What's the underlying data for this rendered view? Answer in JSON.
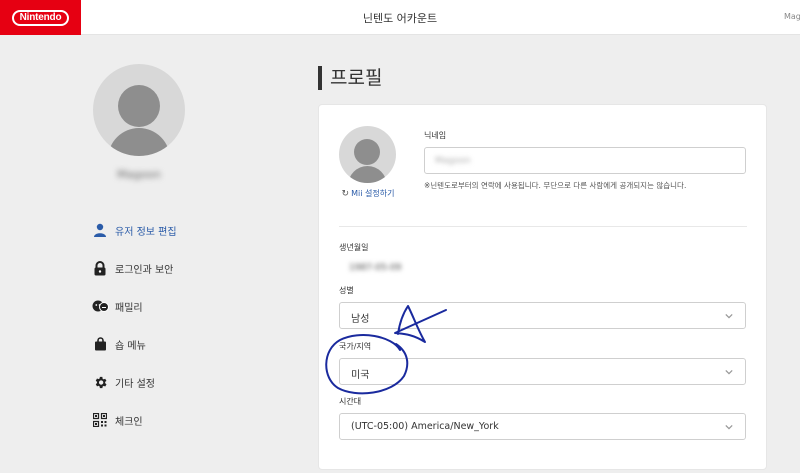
{
  "header": {
    "logo_text": "Nintendo",
    "title": "닌텐도 어카운트",
    "user_label": "Mag"
  },
  "sidebar": {
    "username": "Magoon",
    "items": [
      {
        "label": "유저 정보 편집",
        "icon": "person-icon",
        "active": true
      },
      {
        "label": "로그인과 보안",
        "icon": "lock-icon",
        "active": false
      },
      {
        "label": "패밀리",
        "icon": "family-icon",
        "active": false
      },
      {
        "label": "숍 메뉴",
        "icon": "shopping-bag-icon",
        "active": false
      },
      {
        "label": "기타 설정",
        "icon": "gear-icon",
        "active": false
      },
      {
        "label": "체크인",
        "icon": "qr-code-icon",
        "active": false
      }
    ]
  },
  "profile": {
    "section_title": "프로필",
    "mii_link": "Mii 설정하기",
    "nickname_label": "닉네임",
    "nickname_value": "Magoon",
    "nickname_note": "※닌텐도로부터의 연락에 사용됩니다. 무단으로 다른 사람에게 공개되지는 않습니다.",
    "birthday_label": "생년월일",
    "birthday_value": "1987-05-09",
    "gender_label": "성별",
    "gender_value": "남성",
    "country_label": "국가/지역",
    "country_value": "미국",
    "timezone_label": "시간대",
    "timezone_value": "(UTC-05:00) America/New_York"
  },
  "colors": {
    "brand_red": "#e60012",
    "link_blue": "#2a5ba8",
    "annotation_ink": "#1a2a9e"
  }
}
